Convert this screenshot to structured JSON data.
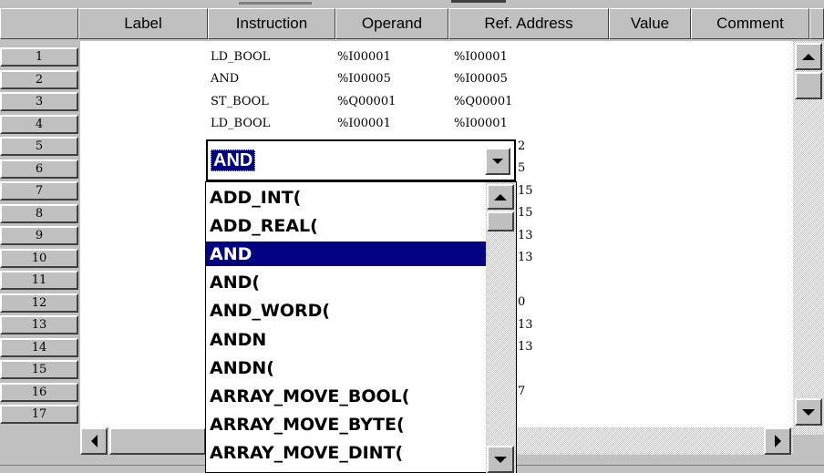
{
  "columns": [
    "Label",
    "Instruction",
    "Operand",
    "Ref. Address",
    "Value",
    "Comment"
  ],
  "rows": [
    "1",
    "2",
    "3",
    "4",
    "5",
    "6",
    "7",
    "8",
    "9",
    "10",
    "11",
    "12",
    "13",
    "14",
    "15",
    "16",
    "17"
  ],
  "grid_rows": [
    {
      "instruction": "LD_BOOL",
      "operand": "%I00001",
      "ref": "%I00001"
    },
    {
      "instruction": "AND",
      "operand": "%I00005",
      "ref": "%I00005"
    },
    {
      "instruction": "ST_BOOL",
      "operand": "%Q00001",
      "ref": "%Q00001"
    },
    {
      "instruction": "LD_BOOL",
      "operand": "%I00001",
      "ref": "%I00001"
    }
  ],
  "ref_fragments": [
    "2",
    "5",
    "15",
    "15",
    "13",
    "13",
    "",
    "0",
    "13",
    "13",
    "",
    "7"
  ],
  "editor": {
    "value": "AND"
  },
  "dropdown": {
    "items": [
      "ADD_INT(",
      "ADD_REAL(",
      "AND",
      "AND(",
      "AND_WORD(",
      "ANDN",
      "ANDN(",
      "ARRAY_MOVE_BOOL(",
      "ARRAY_MOVE_BYTE(",
      "ARRAY_MOVE_DINT("
    ],
    "selected_index": 2
  }
}
